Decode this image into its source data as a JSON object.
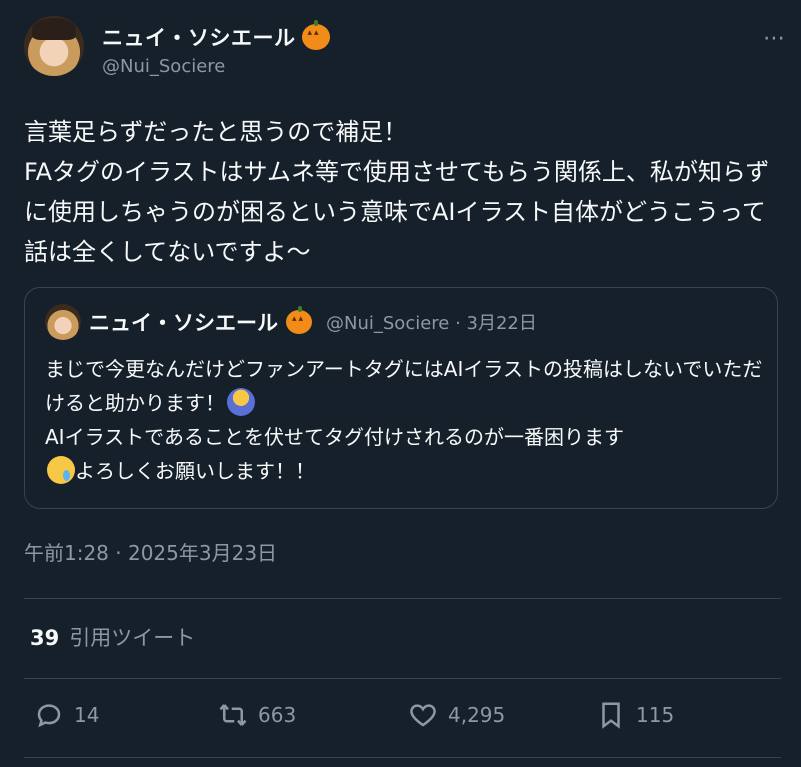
{
  "tweet": {
    "author": {
      "display_name": "ニュイ・ソシエール",
      "handle": "@Nui_Sociere",
      "name_emoji": "pumpkin-icon"
    },
    "more_icon": "⋯",
    "text": "言葉足らずだったと思うので補足！\nFAタグのイラストはサムネ等で使用させてもらう関係上、私が知らずに使用しちゃうのが困るという意味でAIイラスト自体がどうこうって話は全くしてないですよ～",
    "timestamp": "午前1:28 · 2025年3月23日"
  },
  "quoted_tweet": {
    "display_name": "ニュイ・ソシエール",
    "meta": "@Nui_Sociere · 3月22日",
    "line1": "まじで今更なんだけどファンアートタグにはAIイラストの投稿はしないでいただけると助かります！",
    "line2": "AIイラストであることを伏せてタグ付けされるのが一番困ります",
    "line3": "よろしくお願いします！！",
    "emoji1": "person-bowing-icon",
    "emoji2": "face-holding-back-tears-icon"
  },
  "quotes": {
    "count": "39",
    "label": "引用ツイート"
  },
  "actions": {
    "reply": "14",
    "retweet": "663",
    "like": "4,295",
    "bookmark": "115"
  },
  "colors": {
    "background": "#15202b",
    "text": "#f7f9f9",
    "secondary": "#8b98a5",
    "border": "#38444d"
  }
}
